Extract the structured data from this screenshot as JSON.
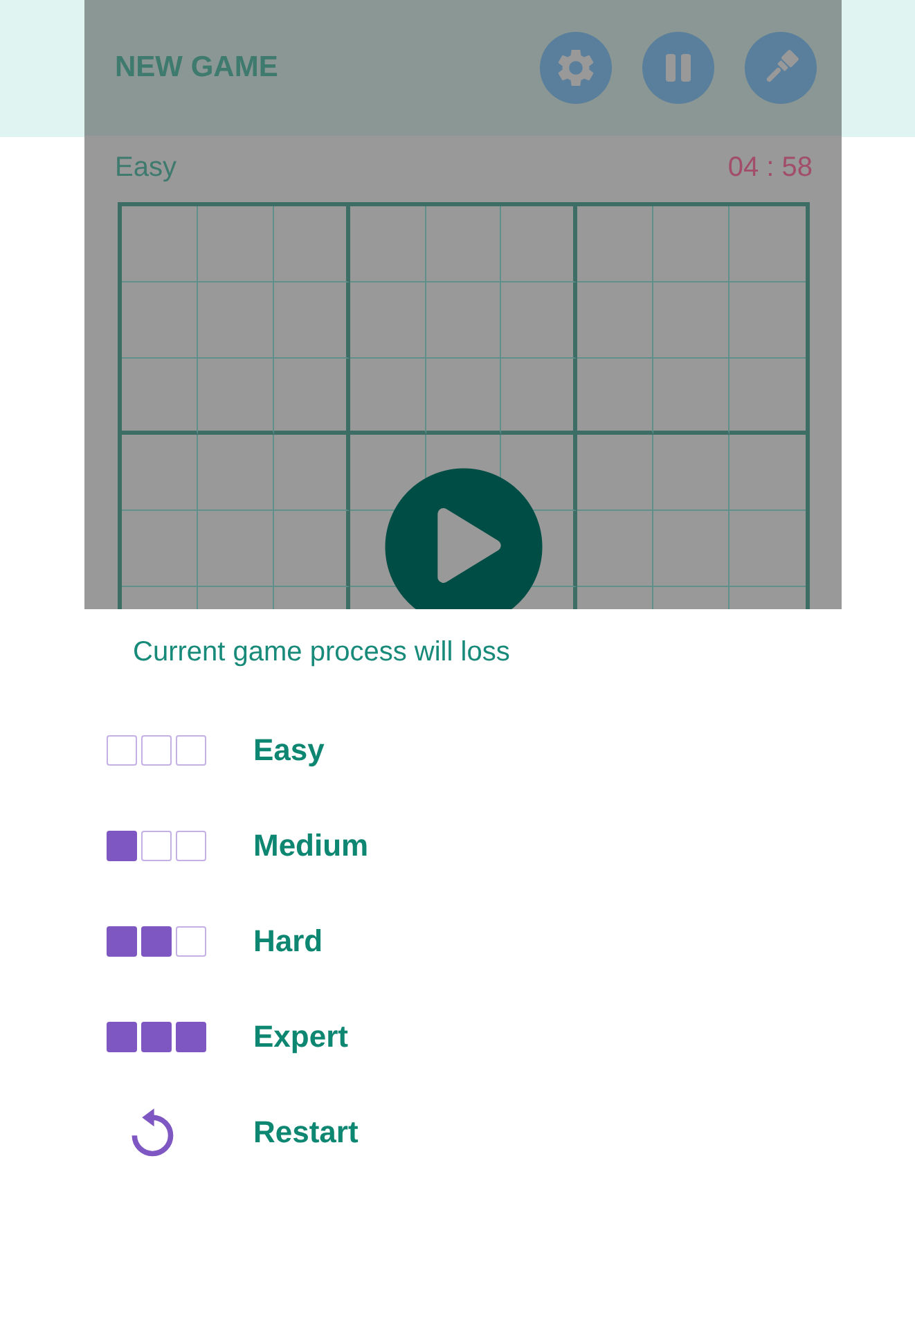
{
  "header": {
    "title": "NEW GAME"
  },
  "status": {
    "difficulty": "Easy",
    "timer": "04 : 58"
  },
  "dialog": {
    "message": "Current game process will loss",
    "options": [
      {
        "kind": "level",
        "label": "Easy",
        "stars": 0
      },
      {
        "kind": "level",
        "label": "Medium",
        "stars": 1
      },
      {
        "kind": "level",
        "label": "Hard",
        "stars": 2
      },
      {
        "kind": "level",
        "label": "Expert",
        "stars": 3
      },
      {
        "kind": "restart",
        "label": "Restart"
      }
    ]
  }
}
